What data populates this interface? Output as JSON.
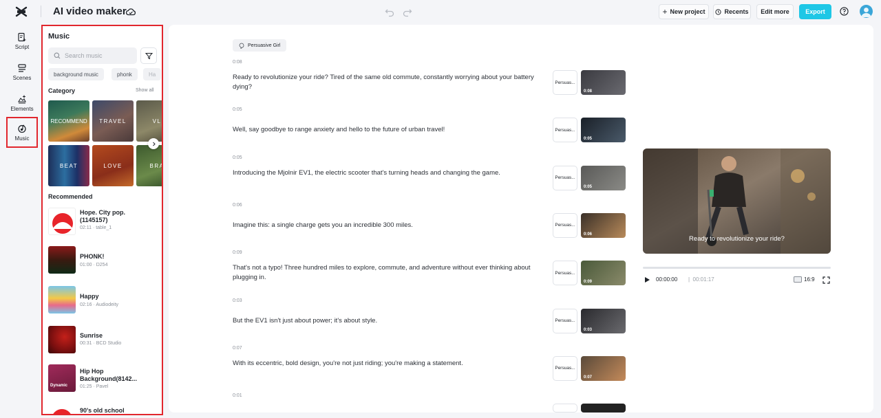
{
  "header": {
    "app_title": "AI video maker",
    "new_project": "New project",
    "recents": "Recents",
    "edit_more": "Edit more",
    "export": "Export"
  },
  "nav": {
    "items": [
      {
        "label": "Script",
        "icon": "script-icon"
      },
      {
        "label": "Scenes",
        "icon": "scenes-icon"
      },
      {
        "label": "Elements",
        "icon": "elements-icon"
      },
      {
        "label": "Music",
        "icon": "music-icon",
        "active": true
      }
    ]
  },
  "music": {
    "title": "Music",
    "search_placeholder": "Search music",
    "chips": [
      "background music",
      "phonk",
      "Ha"
    ],
    "category_label": "Category",
    "show_all": "Show all",
    "categories": [
      {
        "label": "RECOMMEND",
        "color": "#2e6e5a"
      },
      {
        "label": "TRAVEL",
        "color": "#5a4a52"
      },
      {
        "label": "VL",
        "color": "#7a7458"
      },
      {
        "label": "BEAT",
        "color": "#24365e"
      },
      {
        "label": "LOVE",
        "color": "#a3461c"
      },
      {
        "label": "BRA",
        "color": "#4e6a3a"
      }
    ],
    "recommended_label": "Recommended",
    "tracks": [
      {
        "name": "Hope. City pop. (1145157)",
        "meta": "02:11 · table_1"
      },
      {
        "name": "PHONK!",
        "meta": "01:00 · D254"
      },
      {
        "name": "Happy",
        "meta": "02:16 · Audiodeity"
      },
      {
        "name": "Sunrise",
        "meta": "00:31 · BCD Studio"
      },
      {
        "name": "Hip Hop Background(8142...",
        "meta": "01:25 · Pavel",
        "thumb_text": "Dynamic"
      },
      {
        "name": "90's old school",
        "meta": ""
      }
    ]
  },
  "script": {
    "voice": "Persuasive Girl",
    "voice_short": "Persuas...",
    "scenes": [
      {
        "time": "0:08",
        "text": "Ready to revolutionize your ride? Tired of the same old commute, constantly worrying about your battery dying?",
        "dur": "0:08"
      },
      {
        "time": "0:05",
        "text": "Well, say goodbye to range anxiety and hello to the future of urban travel!",
        "dur": "0:05"
      },
      {
        "time": "0:05",
        "text": "Introducing the Mjolnir EV1, the electric scooter that's turning heads and changing the game.",
        "dur": "0:05"
      },
      {
        "time": "0:06",
        "text": "Imagine this: a single charge gets you an incredible 300 miles.",
        "dur": "0:06"
      },
      {
        "time": "0:09",
        "text": "That's not a typo! Three hundred miles to explore, commute, and adventure without ever thinking about plugging in.",
        "dur": "0:09"
      },
      {
        "time": "0:03",
        "text": "But the EV1 isn't just about power; it's about style.",
        "dur": "0:03"
      },
      {
        "time": "0:07",
        "text": "With its eccentric, bold design, you're not just riding; you're making a statement.",
        "dur": "0:07"
      },
      {
        "time": "0:01",
        "text": "",
        "dur": ""
      }
    ]
  },
  "player": {
    "caption": "Ready to revolutionize your ride?",
    "current_time": "00:00:00",
    "total_time": "00:01:17",
    "ratio": "16:9"
  }
}
